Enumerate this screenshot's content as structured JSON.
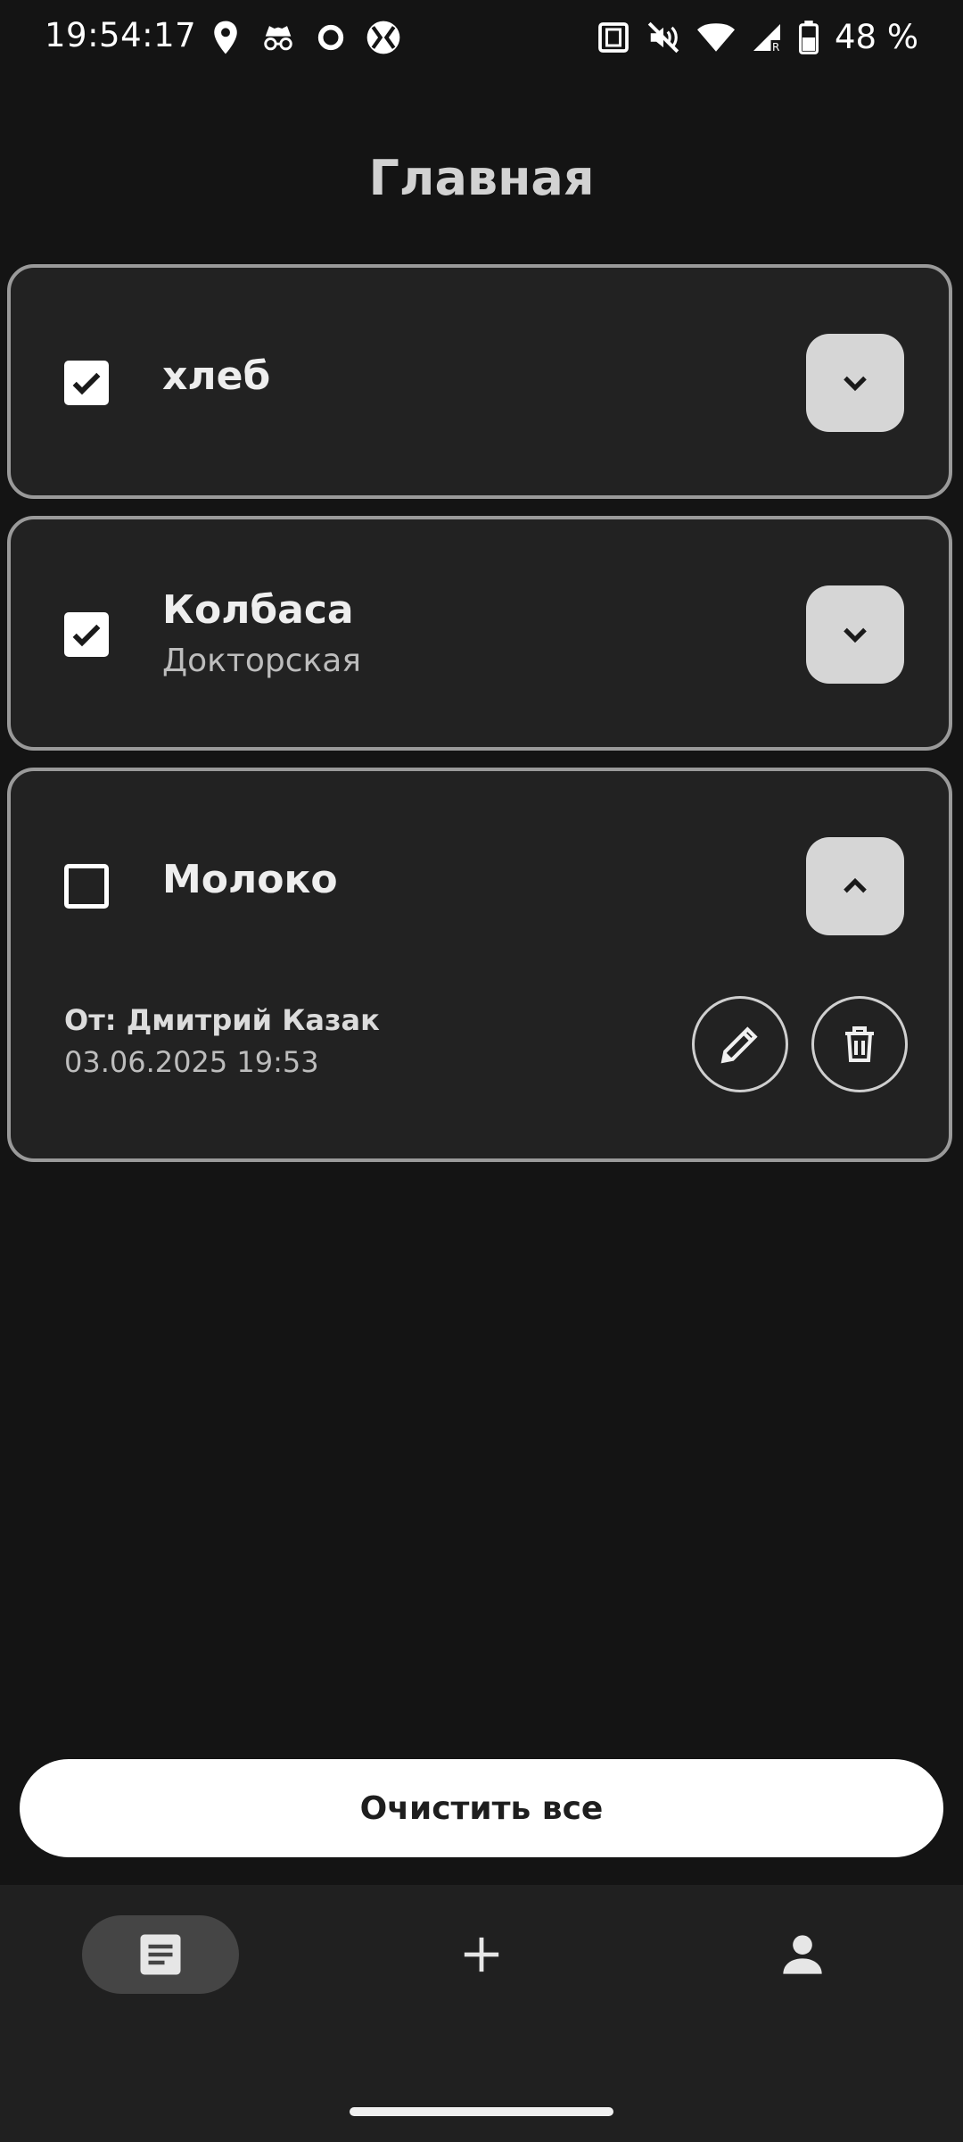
{
  "status_bar": {
    "time": "19:54:17",
    "battery": "48 %",
    "icons_left": [
      "location-icon",
      "incognito-icon",
      "circle-icon",
      "crosshair-icon"
    ],
    "icons_right": [
      "nfc-icon",
      "mute-icon",
      "wifi-icon",
      "signal-icon",
      "battery-icon"
    ]
  },
  "header": {
    "title": "Главная"
  },
  "items": [
    {
      "title": "хлеб",
      "subtitle": "",
      "checked": true,
      "expanded": false
    },
    {
      "title": "Колбаса",
      "subtitle": "Докторская",
      "checked": true,
      "expanded": false
    },
    {
      "title": "Молоко",
      "subtitle": "",
      "checked": false,
      "expanded": true,
      "from": "От: Дмитрий Казак",
      "date": "03.06.2025 19:53"
    }
  ],
  "actions": {
    "clear_all_label": "Очистить все"
  },
  "bottom_nav": {
    "items": [
      "lists-icon",
      "add-icon",
      "profile-icon"
    ],
    "active": "lists-icon"
  },
  "colors": {
    "background": "#141414",
    "card": "#222222",
    "card_border": "#9a9a9a",
    "button_light": "#d6d6d6"
  }
}
